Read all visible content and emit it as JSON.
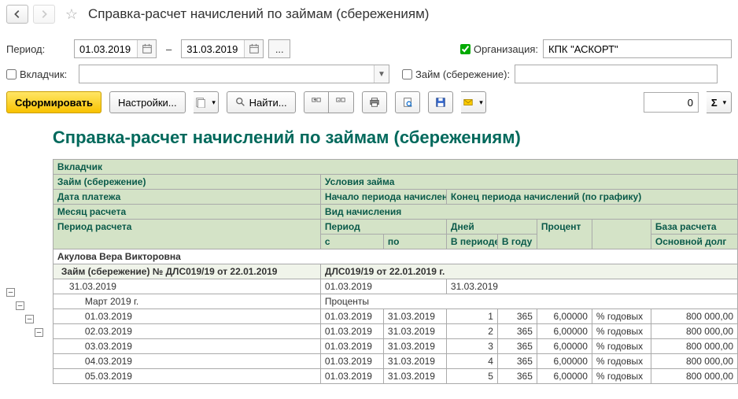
{
  "title": "Справка-расчет начислений по займам (сбережениям)",
  "params": {
    "period_label": "Период:",
    "date_from": "01.03.2019",
    "date_to": "31.03.2019",
    "org_label": "Организация:",
    "org_value": "КПК \"АСКОРТ\"",
    "depositor_label": "Вкладчик:",
    "loan_label": "Займ (сбережение):"
  },
  "toolbar": {
    "generate": "Сформировать",
    "settings": "Настройки...",
    "find": "Найти...",
    "num_value": "0",
    "sigma": "Σ"
  },
  "report": {
    "title": "Справка-расчет начислений по займам (сбережениям)",
    "headers": {
      "depositor": "Вкладчик",
      "loan": "Займ (сбережение)",
      "loan_terms": "Условия займа",
      "pay_date": "Дата платежа",
      "period_start": "Начало периода начислений (по графику)",
      "period_end": "Конец периода начислений (по графику)",
      "calc_month": "Месяц расчета",
      "accrual_type": "Вид начисления",
      "calc_period": "Период расчета",
      "period": "Период",
      "from": "с",
      "to": "по",
      "days": "Дней",
      "in_period": "В периоде",
      "in_year": "В году",
      "percent": "Процент",
      "base": "База расчета",
      "principal": "Основной долг"
    },
    "rows": [
      {
        "lvl": 1,
        "name": "Акулова Вера Викторовна"
      },
      {
        "lvl": 2,
        "name": "Займ (сбережение) № ДЛС019/19 от 22.01.2019",
        "terms": "ДЛС019/19 от 22.01.2019 г."
      },
      {
        "lvl": 3,
        "date": "31.03.2019",
        "start": "01.03.2019",
        "end": "31.03.2019"
      },
      {
        "lvl": 4,
        "month": "Март 2019 г.",
        "type": "Проценты"
      },
      {
        "lvl": 5,
        "d": "01.03.2019",
        "s": "01.03.2019",
        "e": "31.03.2019",
        "dp": "1",
        "dy": "365",
        "pct": "6,00000",
        "pu": "% годовых",
        "base": "800 000,00"
      },
      {
        "lvl": 5,
        "d": "02.03.2019",
        "s": "01.03.2019",
        "e": "31.03.2019",
        "dp": "2",
        "dy": "365",
        "pct": "6,00000",
        "pu": "% годовых",
        "base": "800 000,00"
      },
      {
        "lvl": 5,
        "d": "03.03.2019",
        "s": "01.03.2019",
        "e": "31.03.2019",
        "dp": "3",
        "dy": "365",
        "pct": "6,00000",
        "pu": "% годовых",
        "base": "800 000,00"
      },
      {
        "lvl": 5,
        "d": "04.03.2019",
        "s": "01.03.2019",
        "e": "31.03.2019",
        "dp": "4",
        "dy": "365",
        "pct": "6,00000",
        "pu": "% годовых",
        "base": "800 000,00"
      },
      {
        "lvl": 5,
        "d": "05.03.2019",
        "s": "01.03.2019",
        "e": "31.03.2019",
        "dp": "5",
        "dy": "365",
        "pct": "6,00000",
        "pu": "% годовых",
        "base": "800 000,00"
      }
    ]
  }
}
